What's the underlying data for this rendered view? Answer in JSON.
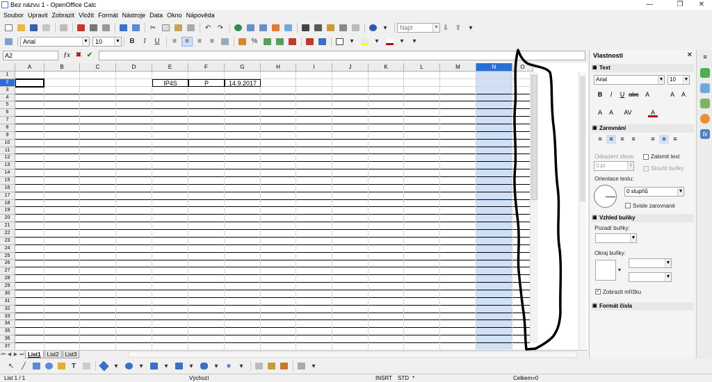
{
  "window": {
    "title": "Bez názvu 1 - OpenOffice Calc",
    "minimize": "—",
    "maximize": "❐",
    "close": "✕"
  },
  "menu": [
    "Soubor",
    "Upravit",
    "Zobrazit",
    "Vložit",
    "Formát",
    "Nástroje",
    "Data",
    "Okno",
    "Nápověda"
  ],
  "toolbar": {
    "find_placeholder": "Najít"
  },
  "format_toolbar": {
    "font": "Arial",
    "size": "10",
    "bold": "B",
    "italic": "I",
    "underline": "U"
  },
  "formula_bar": {
    "cell_ref": "A2",
    "content": ""
  },
  "grid": {
    "columns": [
      "A",
      "B",
      "C",
      "D",
      "E",
      "F",
      "G",
      "H",
      "I",
      "J",
      "K",
      "L",
      "M",
      "N",
      "O"
    ],
    "rows": [
      "1",
      "2",
      "3",
      "4",
      "5",
      "6",
      "7",
      "8",
      "9",
      "10",
      "11",
      "12",
      "13",
      "14",
      "15",
      "16",
      "17",
      "18",
      "19",
      "20",
      "21",
      "22",
      "23",
      "24",
      "25",
      "26",
      "27",
      "28",
      "29",
      "30",
      "31",
      "32",
      "33",
      "34",
      "35",
      "36",
      "37"
    ],
    "selected_column": "N",
    "active_cell": "A2",
    "cells": {
      "E2": "IP4S",
      "F2": "P",
      "G2": "14.9.2017"
    }
  },
  "sheets": [
    "List1",
    "List2",
    "List3"
  ],
  "active_sheet": "List1",
  "status": {
    "page": "List 1 / 1",
    "style": "Výchozí",
    "mode": "INSRT",
    "selection": "STD",
    "modified": "*",
    "sum": "Celkem=0"
  },
  "sidebar": {
    "title": "Vlastnosti",
    "text": {
      "header": "Text",
      "font": "Arial",
      "size": "10"
    },
    "alignment": {
      "header": "Zarovnání",
      "indent_label": "Odsazení zleva:",
      "indent_value": "0 pt",
      "wrap_label": "Zalomit text",
      "merge_label": "Sloučit buňky",
      "orientation_label": "Orientace textu:",
      "orientation_value": "0 stupňů",
      "vertical_label": "Svisle zarovnané"
    },
    "appearance": {
      "header": "Vzhled buňky",
      "background_label": "Pozadí buňky:",
      "border_label": "Okraj buňky:",
      "gridlines_label": "Zobrazit mřížku"
    },
    "number_format": {
      "header": "Formát čísla"
    }
  }
}
